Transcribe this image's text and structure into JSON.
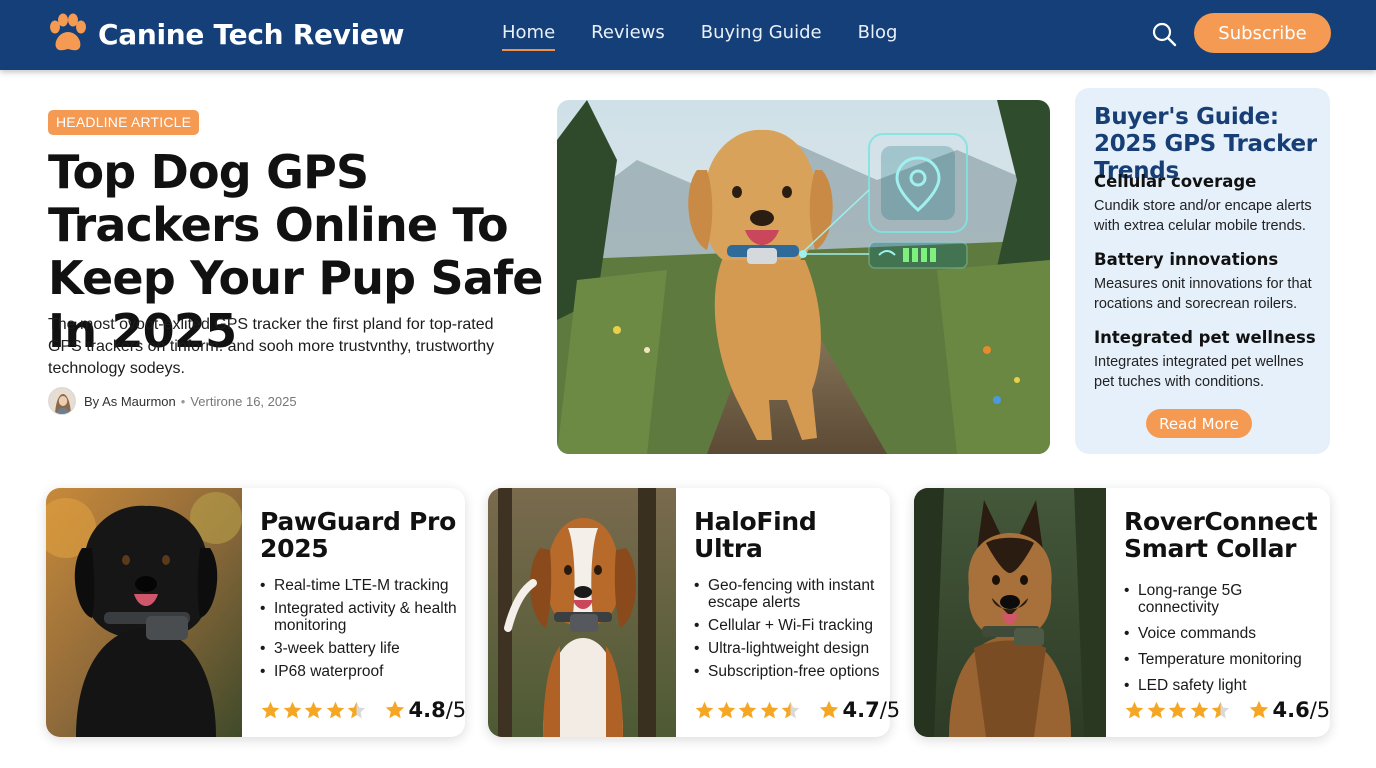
{
  "header": {
    "brand": "Canine Tech Review",
    "nav": [
      "Home",
      "Reviews",
      "Buying Guide",
      "Blog"
    ],
    "active_nav": "Home",
    "subscribe_label": "Subscribe"
  },
  "headline": {
    "tag": "HEADLINE ARTICLE",
    "title": "Top Dog GPS Trackers Online To Keep Your Pup Safe In 2025",
    "summary": "The most ovoot-exlited GPS tracker the first pland for top-rated GPS trackers on tinform. and sooh more trustvnthy, trustworthy technology sodeys.",
    "author": "By As Maurmon",
    "date": "Vertirone 16, 2025"
  },
  "guide": {
    "title": "Buyer's Guide: 2025 GPS Tracker Trends",
    "sections": [
      {
        "title": "Cellular coverage",
        "body": "Cundik store and/or encape alerts with extrea celular mobile trends."
      },
      {
        "title": "Battery innovations",
        "body": "Measures onit innovations for that rocations and sorecrean roilers."
      },
      {
        "title": "Integrated pet wellness",
        "body": "Integrates integrated pet wellnes pet tuches with conditions."
      }
    ],
    "read_more_label": "Read More"
  },
  "products": [
    {
      "title": "PawGuard Pro 2025",
      "features": [
        "Real-time LTE-M tracking",
        "Integrated activity & health monitoring",
        "3-week battery life",
        "IP68 waterproof"
      ],
      "rating": "4.8",
      "rating_max": "/5",
      "stars": 4.5
    },
    {
      "title": "HaloFind Ultra",
      "features": [
        "Geo-fencing with instant escape alerts",
        "Cellular + Wi-Fi tracking",
        "Ultra-lightweight design",
        "Subscription-free options"
      ],
      "rating": "4.7",
      "rating_max": "/5",
      "stars": 4.5
    },
    {
      "title": "RoverConnect Smart Collar",
      "features": [
        "Long-range 5G connectivity",
        "Voice commands",
        "Temperature monitoring",
        "LED safety light"
      ],
      "rating": "4.6",
      "rating_max": "/5",
      "stars": 4.5
    }
  ],
  "colors": {
    "header_bg": "#143f78",
    "accent": "#f59a52",
    "guide_bg": "#e6f0fb",
    "guide_title": "#173f75",
    "star": "#f5a623"
  },
  "icons": {
    "brand": "paw-icon",
    "search": "search-icon",
    "star": "star-icon"
  }
}
